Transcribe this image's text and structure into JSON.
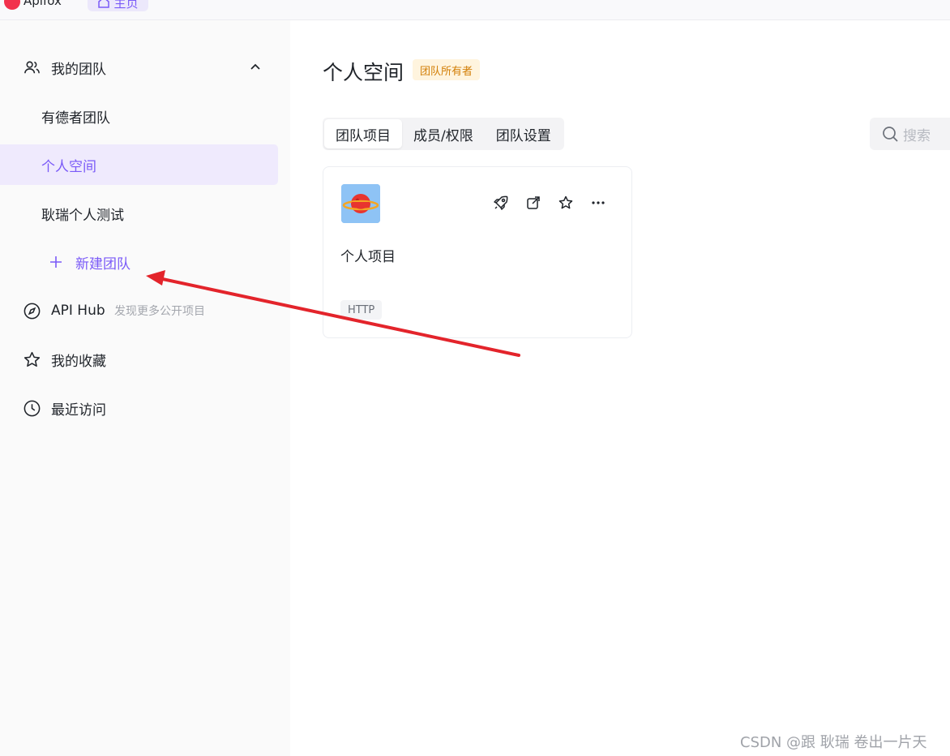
{
  "app": {
    "name": "Apifox",
    "home_tab": "主页"
  },
  "sidebar": {
    "my_teams": {
      "label": "我的团队",
      "icon": "users-icon",
      "expanded": true
    },
    "teams": [
      {
        "label": "有德者团队",
        "active": false
      },
      {
        "label": "个人空间",
        "active": true
      },
      {
        "label": "耿瑞个人测试",
        "active": false
      }
    ],
    "new_team": {
      "label": "新建团队",
      "icon": "plus-icon"
    },
    "api_hub": {
      "label": "API Hub",
      "hint": "发现更多公开项目",
      "icon": "compass-icon"
    },
    "favorites": {
      "label": "我的收藏",
      "icon": "star-icon"
    },
    "recent": {
      "label": "最近访问",
      "icon": "clock-icon"
    }
  },
  "main": {
    "title": "个人空间",
    "owner_badge": "团队所有者",
    "tabs": [
      {
        "label": "团队项目",
        "active": true
      },
      {
        "label": "成员/权限",
        "active": false
      },
      {
        "label": "团队设置",
        "active": false
      }
    ],
    "search_placeholder": "搜索",
    "projects": [
      {
        "name": "个人项目",
        "tag": "HTTP",
        "icon": "planet-icon",
        "actions": [
          "rocket-icon",
          "external-link-icon",
          "star-icon",
          "more-icon"
        ]
      }
    ]
  },
  "watermark": "CSDN @跟 耿瑞 卷出一片天",
  "colors": {
    "accent": "#7a5af8",
    "badge_text": "#d27e06",
    "annotation_arrow": "#e3242b"
  }
}
